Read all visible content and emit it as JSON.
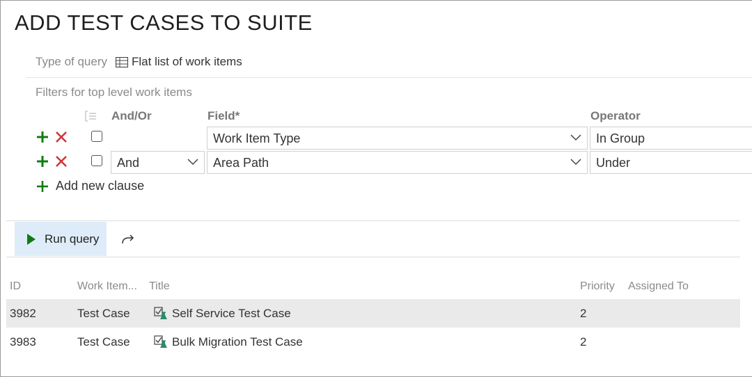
{
  "dialog": {
    "title": "ADD TEST CASES TO SUITE"
  },
  "query_type": {
    "label": "Type of query",
    "value": "Flat list of work items",
    "icon": "table-grid-icon"
  },
  "filters": {
    "label": "Filters for top level work items",
    "headers": {
      "and_or": "And/Or",
      "field": "Field*",
      "operator": "Operator"
    },
    "clauses": [
      {
        "and_or": "",
        "field": "Work Item Type",
        "operator": "In Group"
      },
      {
        "and_or": "And",
        "field": "Area Path",
        "operator": "Under"
      }
    ],
    "add_clause_label": "Add new clause",
    "colors": {
      "add": "#107c10",
      "remove": "#d13438"
    }
  },
  "toolbar": {
    "run_label": "Run query",
    "colors": {
      "run_bg": "#deecf9",
      "run_icon": "#107c10"
    }
  },
  "results": {
    "columns": {
      "id": "ID",
      "type": "Work Item...",
      "title": "Title",
      "priority": "Priority",
      "assigned": "Assigned To"
    },
    "rows": [
      {
        "id": "3982",
        "type": "Test Case",
        "title": "Self Service Test Case",
        "priority": "2",
        "assigned": ""
      },
      {
        "id": "3983",
        "type": "Test Case",
        "title": "Bulk Migration Test Case",
        "priority": "2",
        "assigned": ""
      }
    ]
  }
}
